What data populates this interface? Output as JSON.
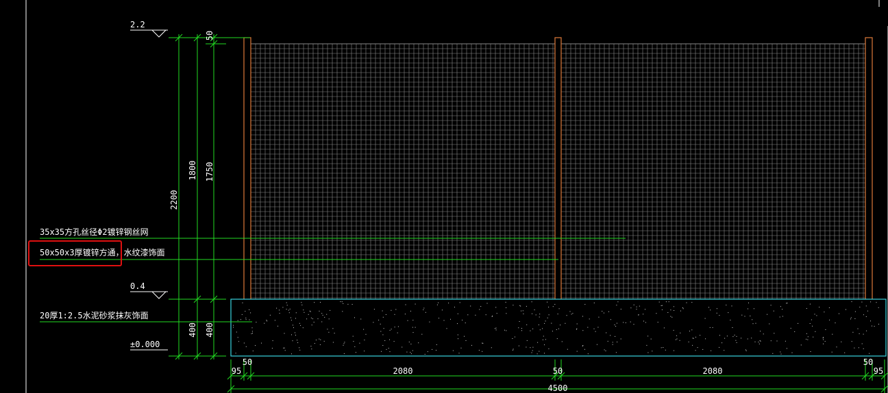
{
  "colors": {
    "background": "#000000",
    "dimension": "#22dd22",
    "text": "#ffffff",
    "post": "#e07a3a",
    "mesh": "#9a9a9a",
    "base_outline": "#39d5e0",
    "highlight": "#e01010"
  },
  "elevations": {
    "top": "2.2",
    "base_top": "0.4",
    "ground": "±0.000"
  },
  "vertical_dims": {
    "total": "2200",
    "fence": "1800",
    "mesh": "1750",
    "top_gap": "50",
    "base_a": "400",
    "base_b": "400"
  },
  "horizontal_dims": {
    "left_edge": "95",
    "left_post": "50",
    "left_span": "2080",
    "mid_post": "50",
    "right_span": "2080",
    "right_post": "50",
    "right_edge": "95",
    "overall": "4500"
  },
  "annotations": {
    "mesh_note": "35x35方孔丝径Φ2镀锌钢丝网",
    "post_note": "50x50x3厚镀锌方通，水纹漆饰面",
    "base_note": "20厚1:2.5水泥砂浆抹灰饰面"
  }
}
